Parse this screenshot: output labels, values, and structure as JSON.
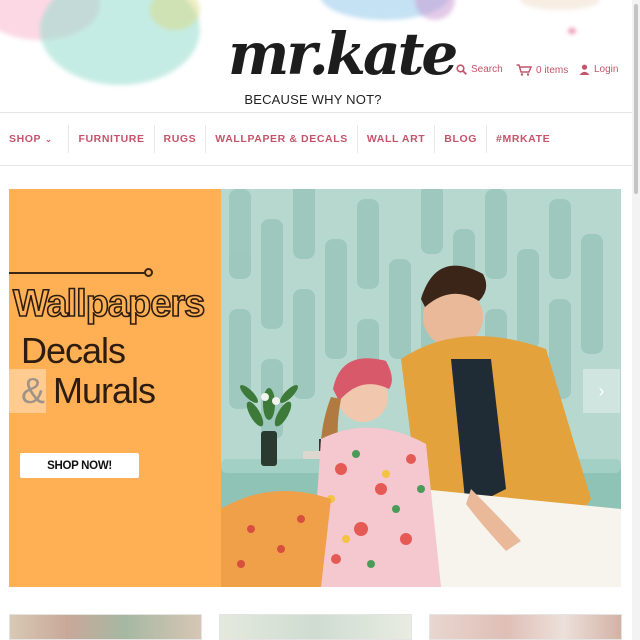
{
  "logo": {
    "wordmark": "mr.kate",
    "tagline": "BECAUSE WHY NOT?"
  },
  "utility": {
    "search_label": "Search",
    "cart_label": "0 items",
    "login_label": "Login"
  },
  "nav": {
    "items": [
      {
        "label": "SHOP",
        "has_dropdown": true
      },
      {
        "label": "FURNITURE"
      },
      {
        "label": "RUGS"
      },
      {
        "label": "WALLPAPER & DECALS"
      },
      {
        "label": "WALL ART"
      },
      {
        "label": "BLOG"
      },
      {
        "label": "#MRKATE"
      }
    ]
  },
  "hero": {
    "line1": "Wallpapers",
    "line2": "Decals",
    "amp": "&",
    "line3": "Murals",
    "cta": "SHOP NOW!",
    "next_arrow": "›"
  },
  "colors": {
    "accent": "#c5546a",
    "hero_orange": "#ffb055",
    "hero_text": "#2d1c10",
    "hero_bg": "#b9d9d1"
  },
  "icons": [
    "search-icon",
    "cart-icon",
    "user-icon",
    "chevron-down-icon",
    "chevron-right-icon"
  ]
}
